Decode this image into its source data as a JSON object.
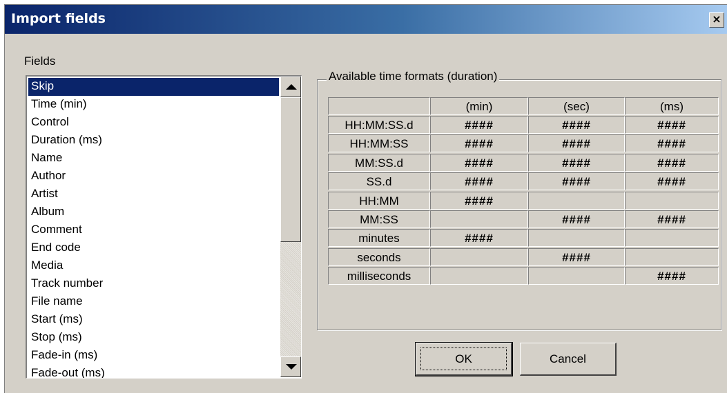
{
  "window": {
    "title": "Import fields",
    "close_label": "×"
  },
  "fields": {
    "label": "Fields",
    "items": [
      "Skip",
      "Time (min)",
      "Control",
      "Duration (ms)",
      "Name",
      "Author",
      "Artist",
      "Album",
      "Comment",
      "End code",
      "Media",
      "Track number",
      "File name",
      "Start (ms)",
      "Stop (ms)",
      "Fade-in (ms)",
      "Fade-out (ms)"
    ],
    "selected": "Skip"
  },
  "formats": {
    "label": "Available time formats (duration)",
    "columns": [
      "(min)",
      "(sec)",
      "(ms)"
    ],
    "rows": [
      {
        "name": "HH:MM:SS.d",
        "cells": [
          "####",
          "####",
          "####"
        ]
      },
      {
        "name": "HH:MM:SS",
        "cells": [
          "####",
          "####",
          "####"
        ]
      },
      {
        "name": "MM:SS.d",
        "cells": [
          "####",
          "####",
          "####"
        ]
      },
      {
        "name": "SS.d",
        "cells": [
          "####",
          "####",
          "####"
        ]
      },
      {
        "name": "HH:MM",
        "cells": [
          "####",
          "",
          ""
        ]
      },
      {
        "name": "MM:SS",
        "cells": [
          "",
          "####",
          "####"
        ]
      },
      {
        "name": "minutes",
        "cells": [
          "####",
          "",
          ""
        ]
      },
      {
        "name": "seconds",
        "cells": [
          "",
          "####",
          ""
        ]
      },
      {
        "name": "milliseconds",
        "cells": [
          "",
          "",
          "####"
        ]
      }
    ]
  },
  "buttons": {
    "ok": "OK",
    "cancel": "Cancel"
  },
  "colors": {
    "title_start": "#0a246a",
    "title_end": "#a6caf0",
    "face": "#d4d0c8",
    "selection": "#0a246a"
  }
}
